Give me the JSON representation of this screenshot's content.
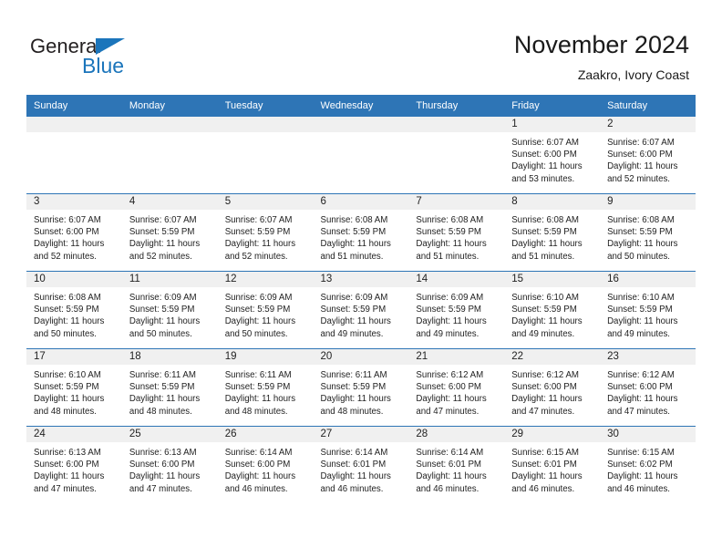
{
  "brand": {
    "name_dark": "General",
    "name_blue": "Blue",
    "accent_color": "#1b75bb"
  },
  "header": {
    "title": "November 2024",
    "subtitle": "Zaakro, Ivory Coast"
  },
  "colors": {
    "header_row": "#2e75b6",
    "daynum_band": "#f0f0f0",
    "text": "#222222"
  },
  "weekdays": [
    "Sunday",
    "Monday",
    "Tuesday",
    "Wednesday",
    "Thursday",
    "Friday",
    "Saturday"
  ],
  "labels": {
    "sunrise_prefix": "Sunrise:",
    "sunset_prefix": "Sunset:",
    "daylight_prefix": "Daylight:"
  },
  "weeks": [
    [
      {
        "day": "",
        "empty": true
      },
      {
        "day": "",
        "empty": true
      },
      {
        "day": "",
        "empty": true
      },
      {
        "day": "",
        "empty": true
      },
      {
        "day": "",
        "empty": true
      },
      {
        "day": "1",
        "sunrise": "Sunrise: 6:07 AM",
        "sunset": "Sunset: 6:00 PM",
        "daylight1": "Daylight: 11 hours",
        "daylight2": "and 53 minutes."
      },
      {
        "day": "2",
        "sunrise": "Sunrise: 6:07 AM",
        "sunset": "Sunset: 6:00 PM",
        "daylight1": "Daylight: 11 hours",
        "daylight2": "and 52 minutes."
      }
    ],
    [
      {
        "day": "3",
        "sunrise": "Sunrise: 6:07 AM",
        "sunset": "Sunset: 6:00 PM",
        "daylight1": "Daylight: 11 hours",
        "daylight2": "and 52 minutes."
      },
      {
        "day": "4",
        "sunrise": "Sunrise: 6:07 AM",
        "sunset": "Sunset: 5:59 PM",
        "daylight1": "Daylight: 11 hours",
        "daylight2": "and 52 minutes."
      },
      {
        "day": "5",
        "sunrise": "Sunrise: 6:07 AM",
        "sunset": "Sunset: 5:59 PM",
        "daylight1": "Daylight: 11 hours",
        "daylight2": "and 52 minutes."
      },
      {
        "day": "6",
        "sunrise": "Sunrise: 6:08 AM",
        "sunset": "Sunset: 5:59 PM",
        "daylight1": "Daylight: 11 hours",
        "daylight2": "and 51 minutes."
      },
      {
        "day": "7",
        "sunrise": "Sunrise: 6:08 AM",
        "sunset": "Sunset: 5:59 PM",
        "daylight1": "Daylight: 11 hours",
        "daylight2": "and 51 minutes."
      },
      {
        "day": "8",
        "sunrise": "Sunrise: 6:08 AM",
        "sunset": "Sunset: 5:59 PM",
        "daylight1": "Daylight: 11 hours",
        "daylight2": "and 51 minutes."
      },
      {
        "day": "9",
        "sunrise": "Sunrise: 6:08 AM",
        "sunset": "Sunset: 5:59 PM",
        "daylight1": "Daylight: 11 hours",
        "daylight2": "and 50 minutes."
      }
    ],
    [
      {
        "day": "10",
        "sunrise": "Sunrise: 6:08 AM",
        "sunset": "Sunset: 5:59 PM",
        "daylight1": "Daylight: 11 hours",
        "daylight2": "and 50 minutes."
      },
      {
        "day": "11",
        "sunrise": "Sunrise: 6:09 AM",
        "sunset": "Sunset: 5:59 PM",
        "daylight1": "Daylight: 11 hours",
        "daylight2": "and 50 minutes."
      },
      {
        "day": "12",
        "sunrise": "Sunrise: 6:09 AM",
        "sunset": "Sunset: 5:59 PM",
        "daylight1": "Daylight: 11 hours",
        "daylight2": "and 50 minutes."
      },
      {
        "day": "13",
        "sunrise": "Sunrise: 6:09 AM",
        "sunset": "Sunset: 5:59 PM",
        "daylight1": "Daylight: 11 hours",
        "daylight2": "and 49 minutes."
      },
      {
        "day": "14",
        "sunrise": "Sunrise: 6:09 AM",
        "sunset": "Sunset: 5:59 PM",
        "daylight1": "Daylight: 11 hours",
        "daylight2": "and 49 minutes."
      },
      {
        "day": "15",
        "sunrise": "Sunrise: 6:10 AM",
        "sunset": "Sunset: 5:59 PM",
        "daylight1": "Daylight: 11 hours",
        "daylight2": "and 49 minutes."
      },
      {
        "day": "16",
        "sunrise": "Sunrise: 6:10 AM",
        "sunset": "Sunset: 5:59 PM",
        "daylight1": "Daylight: 11 hours",
        "daylight2": "and 49 minutes."
      }
    ],
    [
      {
        "day": "17",
        "sunrise": "Sunrise: 6:10 AM",
        "sunset": "Sunset: 5:59 PM",
        "daylight1": "Daylight: 11 hours",
        "daylight2": "and 48 minutes."
      },
      {
        "day": "18",
        "sunrise": "Sunrise: 6:11 AM",
        "sunset": "Sunset: 5:59 PM",
        "daylight1": "Daylight: 11 hours",
        "daylight2": "and 48 minutes."
      },
      {
        "day": "19",
        "sunrise": "Sunrise: 6:11 AM",
        "sunset": "Sunset: 5:59 PM",
        "daylight1": "Daylight: 11 hours",
        "daylight2": "and 48 minutes."
      },
      {
        "day": "20",
        "sunrise": "Sunrise: 6:11 AM",
        "sunset": "Sunset: 5:59 PM",
        "daylight1": "Daylight: 11 hours",
        "daylight2": "and 48 minutes."
      },
      {
        "day": "21",
        "sunrise": "Sunrise: 6:12 AM",
        "sunset": "Sunset: 6:00 PM",
        "daylight1": "Daylight: 11 hours",
        "daylight2": "and 47 minutes."
      },
      {
        "day": "22",
        "sunrise": "Sunrise: 6:12 AM",
        "sunset": "Sunset: 6:00 PM",
        "daylight1": "Daylight: 11 hours",
        "daylight2": "and 47 minutes."
      },
      {
        "day": "23",
        "sunrise": "Sunrise: 6:12 AM",
        "sunset": "Sunset: 6:00 PM",
        "daylight1": "Daylight: 11 hours",
        "daylight2": "and 47 minutes."
      }
    ],
    [
      {
        "day": "24",
        "sunrise": "Sunrise: 6:13 AM",
        "sunset": "Sunset: 6:00 PM",
        "daylight1": "Daylight: 11 hours",
        "daylight2": "and 47 minutes."
      },
      {
        "day": "25",
        "sunrise": "Sunrise: 6:13 AM",
        "sunset": "Sunset: 6:00 PM",
        "daylight1": "Daylight: 11 hours",
        "daylight2": "and 47 minutes."
      },
      {
        "day": "26",
        "sunrise": "Sunrise: 6:14 AM",
        "sunset": "Sunset: 6:00 PM",
        "daylight1": "Daylight: 11 hours",
        "daylight2": "and 46 minutes."
      },
      {
        "day": "27",
        "sunrise": "Sunrise: 6:14 AM",
        "sunset": "Sunset: 6:01 PM",
        "daylight1": "Daylight: 11 hours",
        "daylight2": "and 46 minutes."
      },
      {
        "day": "28",
        "sunrise": "Sunrise: 6:14 AM",
        "sunset": "Sunset: 6:01 PM",
        "daylight1": "Daylight: 11 hours",
        "daylight2": "and 46 minutes."
      },
      {
        "day": "29",
        "sunrise": "Sunrise: 6:15 AM",
        "sunset": "Sunset: 6:01 PM",
        "daylight1": "Daylight: 11 hours",
        "daylight2": "and 46 minutes."
      },
      {
        "day": "30",
        "sunrise": "Sunrise: 6:15 AM",
        "sunset": "Sunset: 6:02 PM",
        "daylight1": "Daylight: 11 hours",
        "daylight2": "and 46 minutes."
      }
    ]
  ]
}
